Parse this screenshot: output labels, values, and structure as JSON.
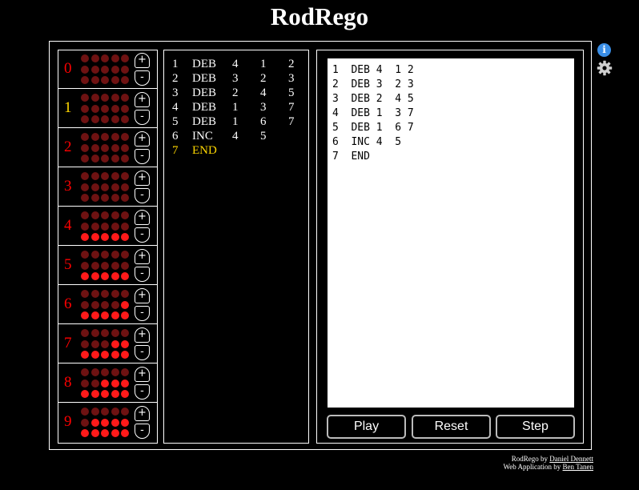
{
  "app": {
    "title": "RodRego"
  },
  "colors": {
    "bead_on": "#ff1a1a",
    "bead_off": "#6e1212",
    "register_label": "#ff0000",
    "highlight": "#ffd700",
    "info": "#3a8ee6"
  },
  "icons": {
    "info": "info-icon",
    "settings": "gear-icon"
  },
  "registers": [
    {
      "label": "0",
      "value": 0
    },
    {
      "label": "1",
      "value": 0
    },
    {
      "label": "2",
      "value": 0
    },
    {
      "label": "3",
      "value": 0
    },
    {
      "label": "4",
      "value": 5
    },
    {
      "label": "5",
      "value": 5
    },
    {
      "label": "6",
      "value": 6
    },
    {
      "label": "7",
      "value": 7
    },
    {
      "label": "8",
      "value": 8
    },
    {
      "label": "9",
      "value": 9
    }
  ],
  "active_register": "1",
  "register_controls": {
    "plus_label": "+",
    "minus_label": "-"
  },
  "program": {
    "current_line": "7",
    "lines": [
      {
        "num": "1",
        "op": "DEB",
        "a": "4",
        "b": "1",
        "c": "2"
      },
      {
        "num": "2",
        "op": "DEB",
        "a": "3",
        "b": "2",
        "c": "3"
      },
      {
        "num": "3",
        "op": "DEB",
        "a": "2",
        "b": "4",
        "c": "5"
      },
      {
        "num": "4",
        "op": "DEB",
        "a": "1",
        "b": "3",
        "c": "7"
      },
      {
        "num": "5",
        "op": "DEB",
        "a": "1",
        "b": "6",
        "c": "7"
      },
      {
        "num": "6",
        "op": "INC",
        "a": "4",
        "b": "5",
        "c": ""
      },
      {
        "num": "7",
        "op": "END",
        "a": "",
        "b": "",
        "c": ""
      }
    ]
  },
  "editor": {
    "text": "1  DEB 4  1 2\n2  DEB 3  2 3\n3  DEB 2  4 5\n4  DEB 1  3 7\n5  DEB 1  6 7\n6  INC 4  5\n7  END"
  },
  "buttons": {
    "play": "Play",
    "reset": "Reset",
    "step": "Step"
  },
  "credits": {
    "line1_prefix": "RodRego by ",
    "line1_link": "Daniel Dennett",
    "line2_prefix": "Web Application by ",
    "line2_link": "Ben Tanen"
  }
}
